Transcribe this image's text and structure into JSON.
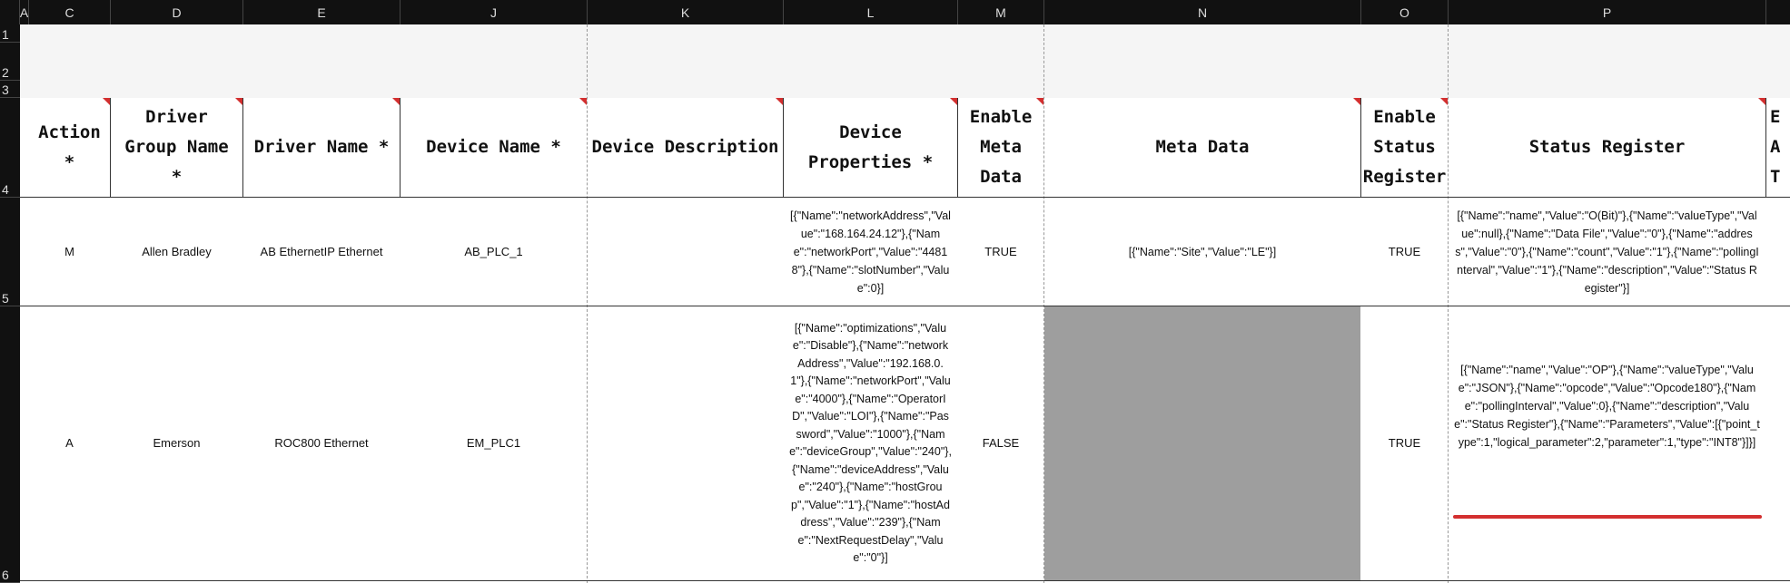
{
  "column_headers": [
    "A",
    "C",
    "D",
    "E",
    "J",
    "K",
    "L",
    "M",
    "N",
    "O",
    "P"
  ],
  "row_headers": [
    "1",
    "2",
    "3",
    "4",
    "5",
    "6"
  ],
  "table": {
    "headers": [
      "Action *",
      "Driver Group Name *",
      "Driver Name *",
      "Device Name *",
      "Device Description",
      "Device Properties *",
      "Enable Meta Data",
      "Meta Data",
      "Enable Status Register",
      "Status Register",
      "E"
    ],
    "partial_header_lines": [
      "E",
      "A",
      "T"
    ],
    "rows": [
      {
        "action": "M",
        "driver_group": "Allen Bradley",
        "driver_name": "AB EthernetIP Ethernet",
        "device_name": "AB_PLC_1",
        "device_description": "",
        "device_properties": "[{\"Name\":\"networkAddress\",\"Value\":\"168.164.24.12\"},{\"Name\":\"networkPort\",\"Value\":\"44818\"},{\"Name\":\"slotNumber\",\"Value\":0}]",
        "enable_meta": "TRUE",
        "meta_data": "[{\"Name\":\"Site\",\"Value\":\"LE\"}]",
        "enable_status": "TRUE",
        "status_register": "[{\"Name\":\"name\",\"Value\":\"O(Bit)\"},{\"Name\":\"valueType\",\"Value\":null},{\"Name\":\"Data File\",\"Value\":\"0\"},{\"Name\":\"address\",\"Value\":\"0\"},{\"Name\":\"count\",\"Value\":\"1\"},{\"Name\":\"pollingInterval\",\"Value\":\"1\"},{\"Name\":\"description\",\"Value\":\"Status Register\"}]"
      },
      {
        "action": "A",
        "driver_group": "Emerson",
        "driver_name": "ROC800 Ethernet",
        "device_name": "EM_PLC1",
        "device_description": "",
        "device_properties": "[{\"Name\":\"optimizations\",\"Value\":\"Disable\"},{\"Name\":\"networkAddress\",\"Value\":\"192.168.0.1\"},{\"Name\":\"networkPort\",\"Value\":\"4000\"},{\"Name\":\"OperatorID\",\"Value\":\"LOI\"},{\"Name\":\"Password\",\"Value\":\"1000\"},{\"Name\":\"deviceGroup\",\"Value\":\"240\"},{\"Name\":\"deviceAddress\",\"Value\":\"240\"},{\"Name\":\"hostGroup\",\"Value\":\"1\"},{\"Name\":\"hostAddress\",\"Value\":\"239\"},{\"Name\":\"NextRequestDelay\",\"Value\":\"0\"}]",
        "enable_meta": "FALSE",
        "meta_data": "",
        "enable_status": "TRUE",
        "status_register": "[{\"Name\":\"name\",\"Value\":\"OP\"},{\"Name\":\"valueType\",\"Value\":\"JSON\"},{\"Name\":\"opcode\",\"Value\":\"Opcode180\"},{\"Name\":\"pollingInterval\",\"Value\":0},{\"Name\":\"description\",\"Value\":\"Status Register\"},{\"Name\":\"Parameters\",\"Value\":[{\"point_type\":1,\"logical_parameter\":2,\"parameter\":1,\"type\":\"INT8\"}]}]"
      }
    ]
  },
  "colors": {
    "header_bar": "#111111",
    "disabled_cell": "#9e9e9e",
    "comment_marker": "#d32f2f",
    "band": "#f5f5f5"
  }
}
